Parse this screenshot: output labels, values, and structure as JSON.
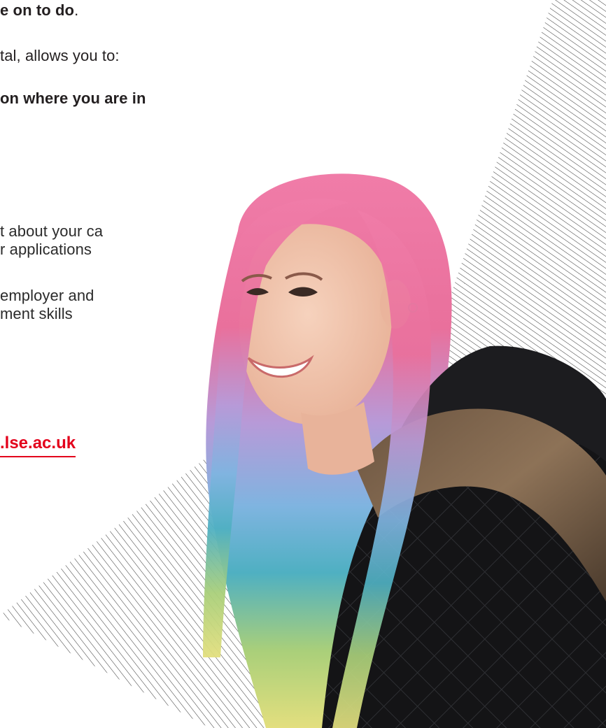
{
  "content": {
    "line_1_bold": "e on to do",
    "line_1_end": ".",
    "line_2": "tal, allows you to:",
    "line_3_bold": "on where you are in",
    "bullet_1_line_1": "t about your ca",
    "bullet_1_line_2": "r applications",
    "bullet_2_line_1": "employer and",
    "bullet_2_line_2": "ment skills",
    "link_text": ".lse.ac.uk"
  },
  "colors": {
    "text": "#231f20",
    "link": "#e3001b",
    "hatch": "#1a1a1a"
  }
}
